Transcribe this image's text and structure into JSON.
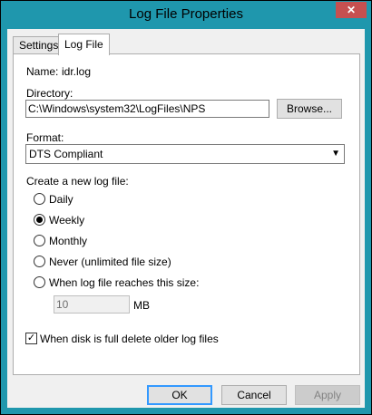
{
  "window": {
    "title": "Log File Properties",
    "close_glyph": "✕"
  },
  "tabs": [
    {
      "label": "Settings"
    },
    {
      "label": "Log File"
    }
  ],
  "name": {
    "label": "Name:",
    "value": "idr.log"
  },
  "directory": {
    "label": "Directory:",
    "value": "C:\\Windows\\system32\\LogFiles\\NPS",
    "browse_label": "Browse..."
  },
  "format": {
    "label": "Format:",
    "value": "DTS Compliant"
  },
  "new_log": {
    "label": "Create a new log file:",
    "options": [
      {
        "label": "Daily",
        "selected": false
      },
      {
        "label": "Weekly",
        "selected": true
      },
      {
        "label": "Monthly",
        "selected": false
      },
      {
        "label": "Never (unlimited file size)",
        "selected": false
      },
      {
        "label": "When log file reaches this size:",
        "selected": false
      }
    ],
    "size_value": "10",
    "size_unit": "MB"
  },
  "delete_older": {
    "label": "When disk is full delete older log files",
    "checked": true,
    "check_glyph": "✓"
  },
  "buttons": {
    "ok": "OK",
    "cancel": "Cancel",
    "apply": "Apply"
  },
  "colors": {
    "title_bar": "#1f97ad",
    "close_button": "#c75050",
    "default_button_border": "#3399ff"
  }
}
